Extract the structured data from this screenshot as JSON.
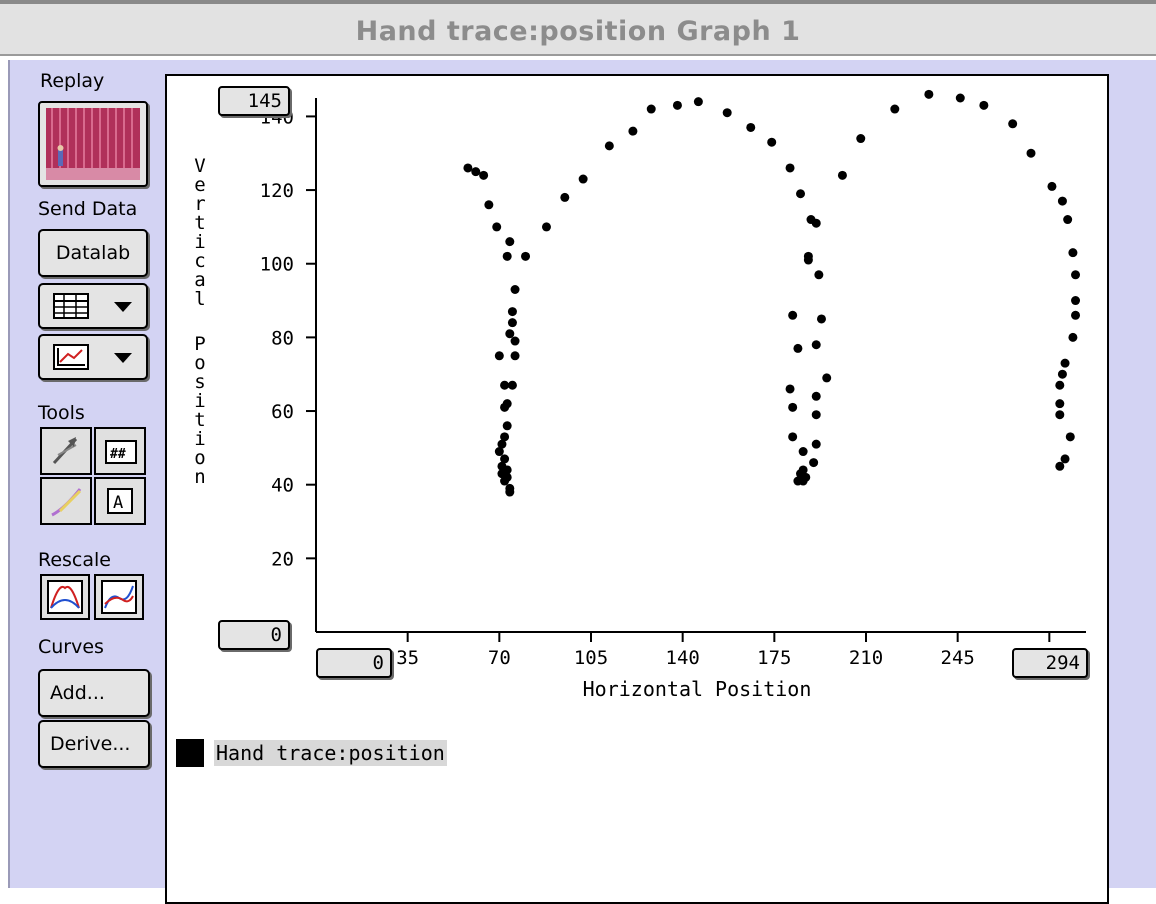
{
  "window": {
    "title": "Hand trace:position Graph 1"
  },
  "sidebar": {
    "replay_label": "Replay",
    "send_data_label": "Send Data",
    "datalab_button": "Datalab",
    "tools_label": "Tools",
    "rescale_label": "Rescale",
    "curves_label": "Curves",
    "add_button": "Add...",
    "derive_button": "Derive..."
  },
  "scales": {
    "y_max": "145",
    "y_min": "0",
    "x_min": "0",
    "x_max": "294"
  },
  "legend": {
    "label": "Hand trace:position"
  },
  "chart_data": {
    "type": "scatter",
    "xlabel": "Horizontal Position",
    "ylabel": "Vertical Position",
    "xlim": [
      0,
      294
    ],
    "ylim": [
      0,
      145
    ],
    "x_ticks": [
      35,
      70,
      105,
      140,
      175,
      210,
      245,
      280
    ],
    "x_tick_labels": [
      "35",
      "70",
      "105",
      "140",
      "175",
      "210",
      "245",
      ""
    ],
    "y_ticks": [
      20,
      40,
      60,
      80,
      100,
      120,
      140
    ],
    "y_tick_labels": [
      "20",
      "40",
      "60",
      "80",
      "100",
      "120",
      "140"
    ],
    "grid": false,
    "series": [
      {
        "color": "#000000",
        "points": [
          [
            58,
            126
          ],
          [
            61,
            125
          ],
          [
            64,
            124
          ],
          [
            66,
            116
          ],
          [
            69,
            110
          ],
          [
            74,
            106
          ],
          [
            73,
            102
          ],
          [
            80,
            102
          ],
          [
            88,
            110
          ],
          [
            95,
            118
          ],
          [
            102,
            123
          ],
          [
            112,
            132
          ],
          [
            121,
            136
          ],
          [
            128,
            142
          ],
          [
            138,
            143
          ],
          [
            146,
            144
          ],
          [
            157,
            141
          ],
          [
            166,
            137
          ],
          [
            174,
            133
          ],
          [
            181,
            126
          ],
          [
            185,
            119
          ],
          [
            189,
            112
          ],
          [
            191,
            111
          ],
          [
            188,
            102
          ],
          [
            188,
            101
          ],
          [
            192,
            97
          ],
          [
            182,
            86
          ],
          [
            193,
            85
          ],
          [
            184,
            77
          ],
          [
            191,
            78
          ],
          [
            195,
            69
          ],
          [
            181,
            66
          ],
          [
            191,
            64
          ],
          [
            182,
            61
          ],
          [
            191,
            59
          ],
          [
            182,
            53
          ],
          [
            191,
            51
          ],
          [
            186,
            49
          ],
          [
            190,
            46
          ],
          [
            186,
            44
          ],
          [
            185,
            43
          ],
          [
            187,
            42
          ],
          [
            184,
            41
          ],
          [
            186,
            41
          ],
          [
            76,
            93
          ],
          [
            75,
            87
          ],
          [
            75,
            84
          ],
          [
            74,
            81
          ],
          [
            76,
            79
          ],
          [
            70,
            75
          ],
          [
            76,
            75
          ],
          [
            72,
            67
          ],
          [
            75,
            67
          ],
          [
            72,
            61
          ],
          [
            73,
            62
          ],
          [
            73,
            56
          ],
          [
            72,
            53
          ],
          [
            71,
            51
          ],
          [
            70,
            49
          ],
          [
            72,
            47
          ],
          [
            71,
            45
          ],
          [
            73,
            44
          ],
          [
            71,
            43
          ],
          [
            73,
            42
          ],
          [
            72,
            41
          ],
          [
            74,
            39
          ],
          [
            74,
            38
          ],
          [
            201,
            124
          ],
          [
            208,
            134
          ],
          [
            221,
            142
          ],
          [
            234,
            146
          ],
          [
            246,
            145
          ],
          [
            255,
            143
          ],
          [
            266,
            138
          ],
          [
            273,
            130
          ],
          [
            281,
            121
          ],
          [
            285,
            117
          ],
          [
            287,
            112
          ],
          [
            289,
            103
          ],
          [
            290,
            97
          ],
          [
            290,
            90
          ],
          [
            290,
            86
          ],
          [
            289,
            80
          ],
          [
            286,
            73
          ],
          [
            285,
            70
          ],
          [
            284,
            67
          ],
          [
            284,
            62
          ],
          [
            284,
            59
          ],
          [
            288,
            53
          ],
          [
            286,
            47
          ],
          [
            284,
            45
          ]
        ]
      }
    ]
  }
}
